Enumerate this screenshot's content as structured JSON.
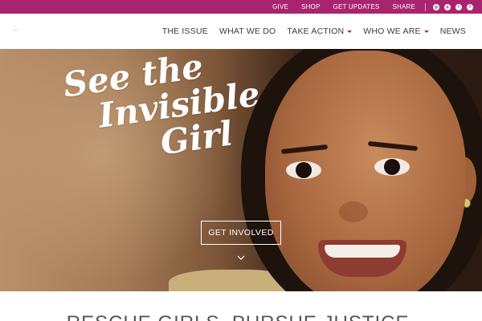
{
  "colors": {
    "brand": "#a8246f",
    "nav_text": "#3a3a3a",
    "tagline_text": "#555555"
  },
  "utility_nav": {
    "links": [
      "GIVE",
      "SHOP",
      "GET UPDATES",
      "SHARE"
    ],
    "social_icons": [
      "instagram-icon",
      "pinterest-icon",
      "twitter-icon",
      "facebook-icon"
    ]
  },
  "main_nav": {
    "items": [
      {
        "label": "THE ISSUE",
        "dropdown": false
      },
      {
        "label": "WHAT WE DO",
        "dropdown": false
      },
      {
        "label": "TAKE ACTION",
        "dropdown": true
      },
      {
        "label": "WHO WE ARE",
        "dropdown": true
      },
      {
        "label": "NEWS",
        "dropdown": false
      }
    ]
  },
  "hero": {
    "title_lines": [
      "See the",
      "Invisible",
      "Girl"
    ],
    "cta_label": "GET INVOLVED",
    "scroll_icon": "chevron-down-icon"
  },
  "tagline": "RESCUE GIRLS. PURSUE JUSTICE."
}
